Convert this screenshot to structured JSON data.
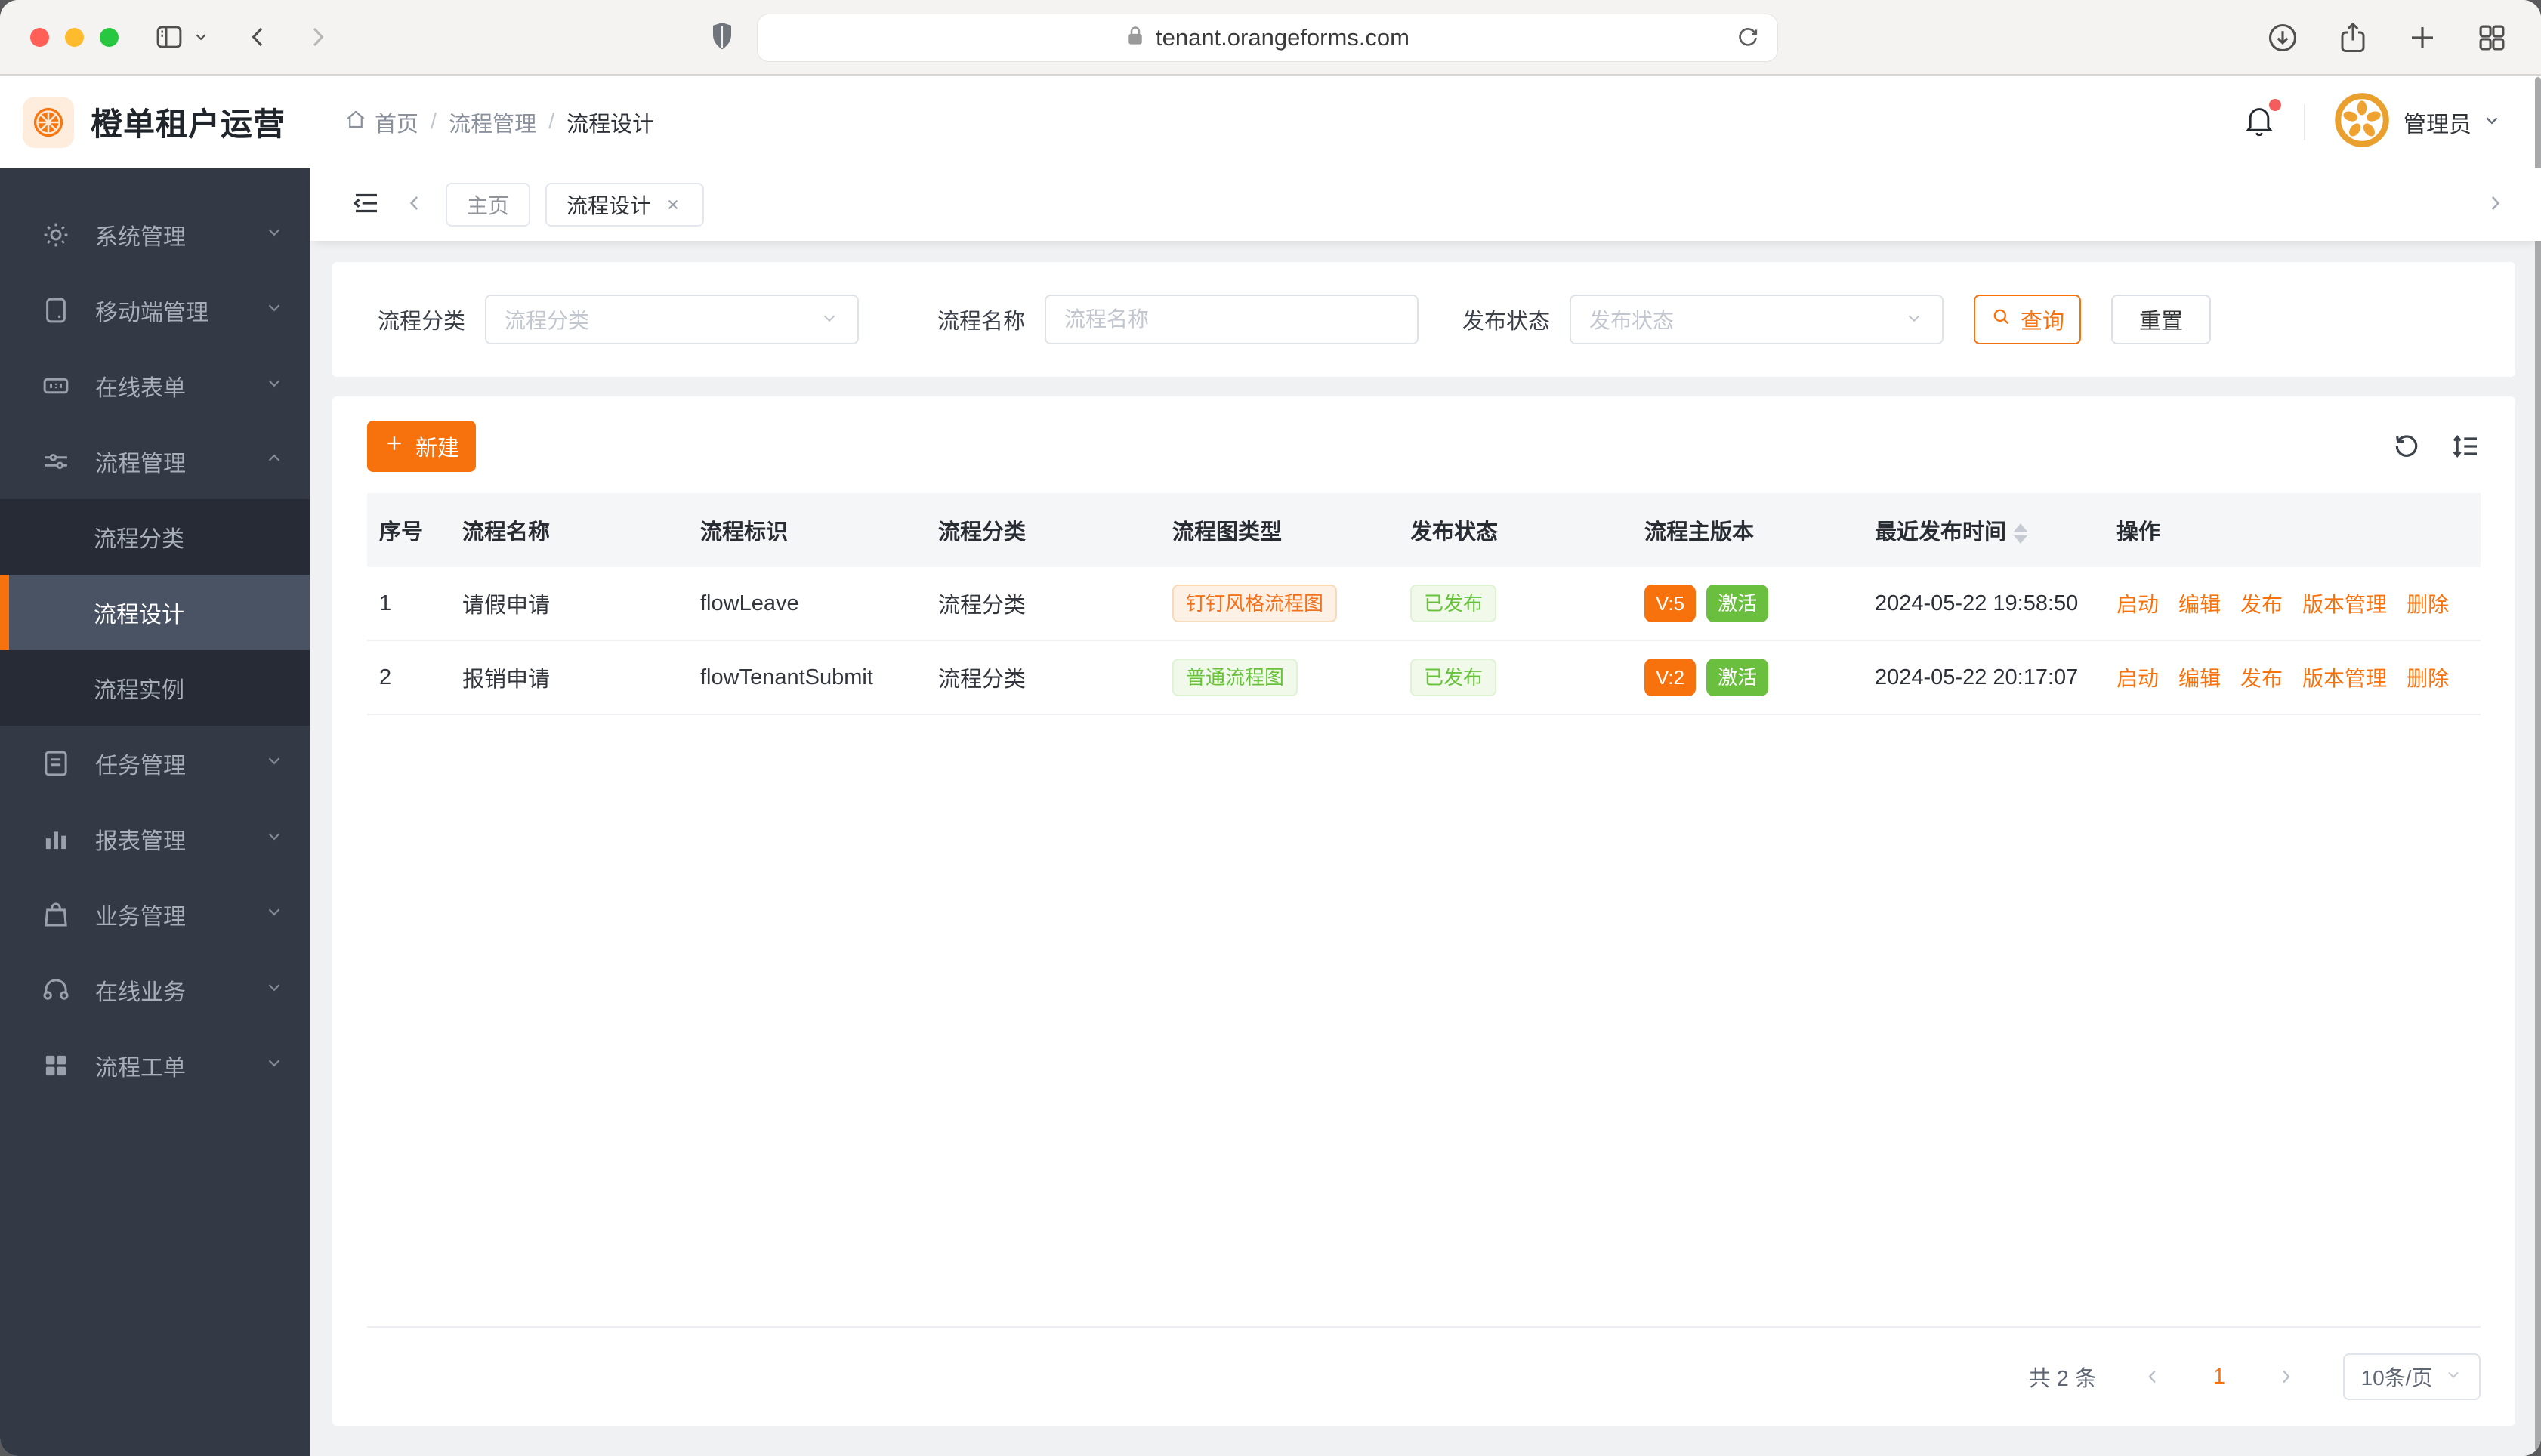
{
  "browser": {
    "url": "tenant.orangeforms.com"
  },
  "header": {
    "app_title": "橙单租户运营",
    "breadcrumb": [
      "首页",
      "流程管理",
      "流程设计"
    ],
    "breadcrumb_sep": "/",
    "user_name": "管理员"
  },
  "sidebar": {
    "items": [
      {
        "label": "系统管理",
        "icon": "gear-icon",
        "expanded": false
      },
      {
        "label": "移动端管理",
        "icon": "mobile-icon",
        "expanded": false
      },
      {
        "label": "在线表单",
        "icon": "form-icon",
        "expanded": false
      },
      {
        "label": "流程管理",
        "icon": "sliders-icon",
        "expanded": true,
        "children": [
          {
            "label": "流程分类",
            "active": false
          },
          {
            "label": "流程设计",
            "active": true
          },
          {
            "label": "流程实例",
            "active": false
          }
        ]
      },
      {
        "label": "任务管理",
        "icon": "tasks-icon",
        "expanded": false
      },
      {
        "label": "报表管理",
        "icon": "bar-chart-icon",
        "expanded": false
      },
      {
        "label": "业务管理",
        "icon": "bag-icon",
        "expanded": false
      },
      {
        "label": "在线业务",
        "icon": "headset-icon",
        "expanded": false
      },
      {
        "label": "流程工单",
        "icon": "grid-icon",
        "expanded": false
      }
    ]
  },
  "tabs": {
    "items": [
      {
        "label": "主页",
        "active": false,
        "closable": false
      },
      {
        "label": "流程设计",
        "active": true,
        "closable": true
      }
    ]
  },
  "filters": {
    "category_label": "流程分类",
    "category_placeholder": "流程分类",
    "name_label": "流程名称",
    "name_placeholder": "流程名称",
    "name_value": "",
    "status_label": "发布状态",
    "status_placeholder": "发布状态",
    "search_label": "查询",
    "reset_label": "重置"
  },
  "toolbar": {
    "create_label": "新建"
  },
  "table": {
    "columns": [
      "序号",
      "流程名称",
      "流程标识",
      "流程分类",
      "流程图类型",
      "发布状态",
      "流程主版本",
      "最近发布时间",
      "操作"
    ],
    "rows": [
      {
        "index": "1",
        "name": "请假申请",
        "key": "flowLeave",
        "category": "流程分类",
        "diagram_type": "钉钉风格流程图",
        "diagram_style": "orange",
        "publish_status": "已发布",
        "version": "V:5",
        "active_label": "激活",
        "published_at": "2024-05-22 19:58:50"
      },
      {
        "index": "2",
        "name": "报销申请",
        "key": "flowTenantSubmit",
        "category": "流程分类",
        "diagram_type": "普通流程图",
        "diagram_style": "green",
        "publish_status": "已发布",
        "version": "V:2",
        "active_label": "激活",
        "published_at": "2024-05-22 20:17:07"
      }
    ],
    "actions": [
      "启动",
      "编辑",
      "发布",
      "版本管理",
      "删除"
    ]
  },
  "pagination": {
    "total_text": "共 2 条",
    "current_page": "1",
    "page_size": "10条/页"
  },
  "colors": {
    "accent": "#f7720d",
    "success_solid": "#6abf3e",
    "success_text": "#67c23a",
    "tag_orange_text": "#f2711c",
    "sidebar_bg": "#333a45",
    "submenu_bg": "#262b36",
    "active_item_bg": "#4a5364",
    "table_header_bg": "#f5f6f8",
    "page_bg": "#f0f1f2"
  },
  "icons": {
    "logo": "orange-citrus-slice",
    "avatar": "orange-citrus-ring",
    "notification": "bell-with-red-dot",
    "search": "magnifier",
    "create": "plus",
    "refresh": "circular-arrow",
    "density": "line-height",
    "sort": "caret-up-down",
    "collapse": "outdent-lines",
    "browser": "safari-chrome"
  }
}
